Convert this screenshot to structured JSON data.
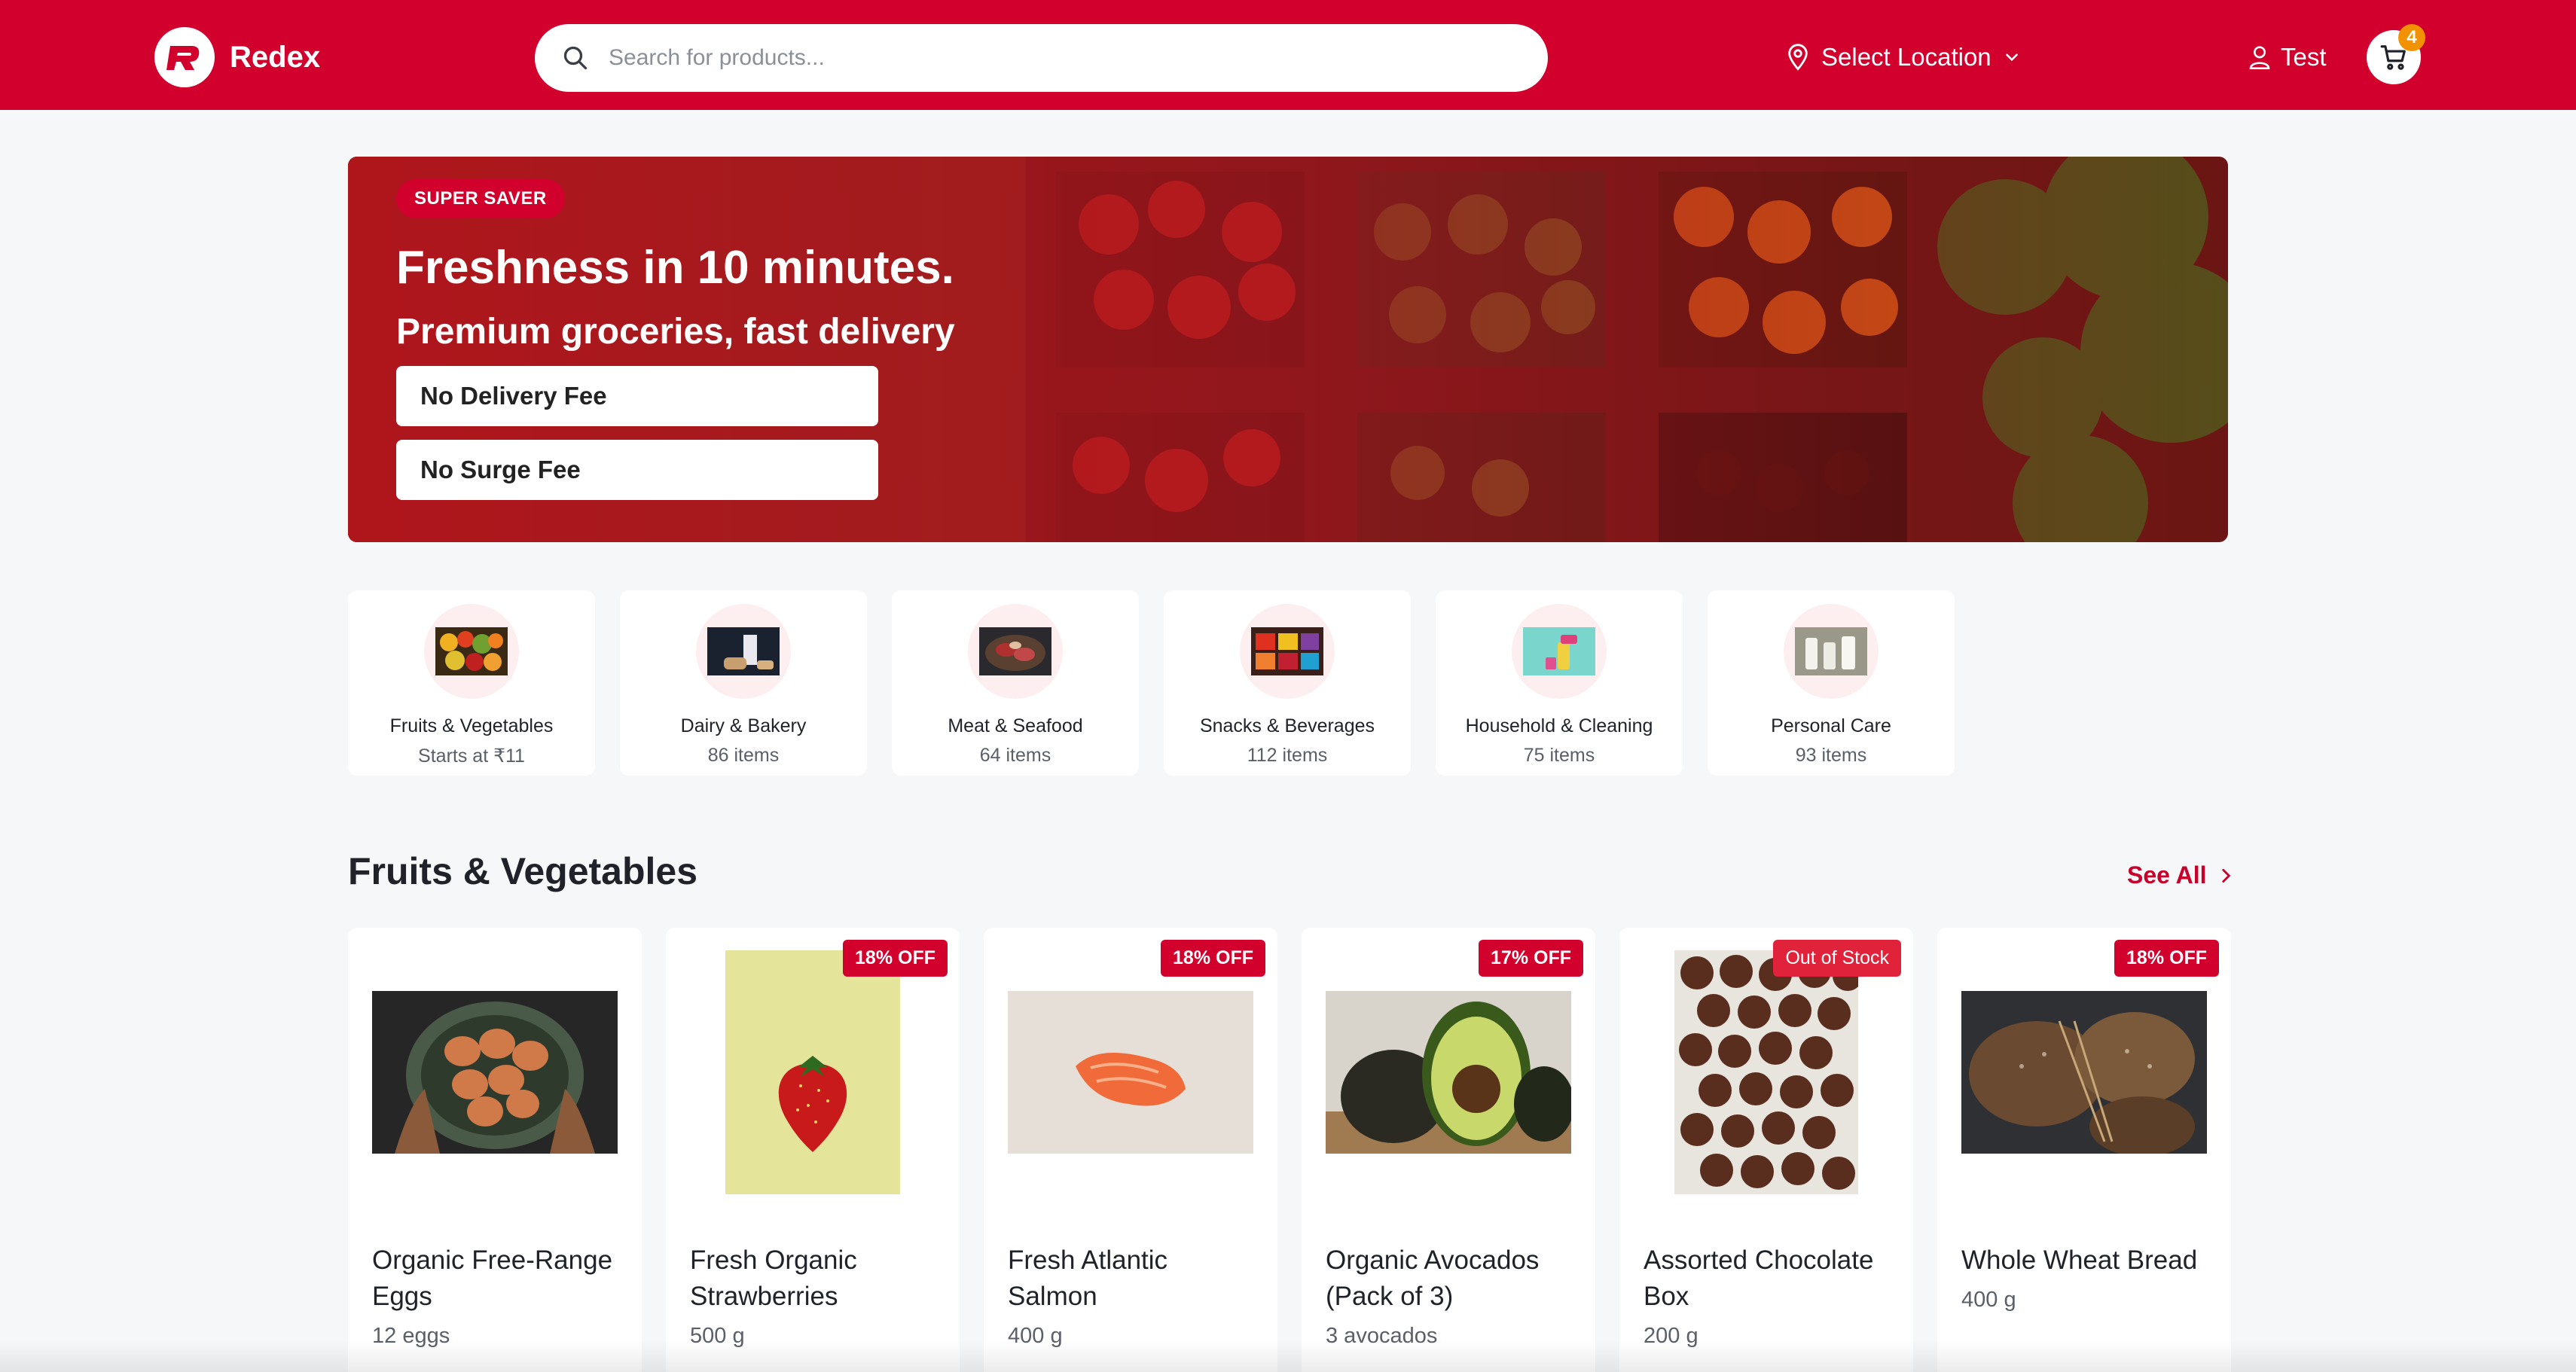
{
  "header": {
    "brand": "Redex",
    "search_placeholder": "Search for products...",
    "location_label": "Select Location",
    "user_label": "Test",
    "cart_count": "4",
    "brand_color": "#d2002d"
  },
  "hero": {
    "tag": "SUPER SAVER",
    "title": "Freshness in 10 minutes.",
    "subtitle": "Premium groceries, fast delivery",
    "features": [
      "No Delivery Fee",
      "No Surge Fee"
    ]
  },
  "categories": [
    {
      "name": "Fruits & Vegetables",
      "count": "Starts at ₹11"
    },
    {
      "name": "Dairy & Bakery",
      "count": "86 items"
    },
    {
      "name": "Meat & Seafood",
      "count": "64 items"
    },
    {
      "name": "Snacks & Beverages",
      "count": "112 items"
    },
    {
      "name": "Household & Cleaning",
      "count": "75 items"
    },
    {
      "name": "Personal Care",
      "count": "93 items"
    }
  ],
  "section": {
    "title": "Fruits & Vegetables",
    "see_all": "See All"
  },
  "products": [
    {
      "name": "Organic Free-Range Eggs",
      "qty": "12 eggs",
      "badge": ""
    },
    {
      "name": "Fresh Organic Strawberries",
      "qty": "500 g",
      "badge": "18% OFF"
    },
    {
      "name": "Fresh Atlantic Salmon",
      "qty": "400 g",
      "badge": "18% OFF"
    },
    {
      "name": "Organic Avocados (Pack of 3)",
      "qty": "3 avocados",
      "badge": "17% OFF"
    },
    {
      "name": "Assorted Chocolate Box",
      "qty": "200 g",
      "badge": "Out of Stock"
    },
    {
      "name": "Whole Wheat Bread",
      "qty": "400 g",
      "badge": "18% OFF"
    }
  ]
}
